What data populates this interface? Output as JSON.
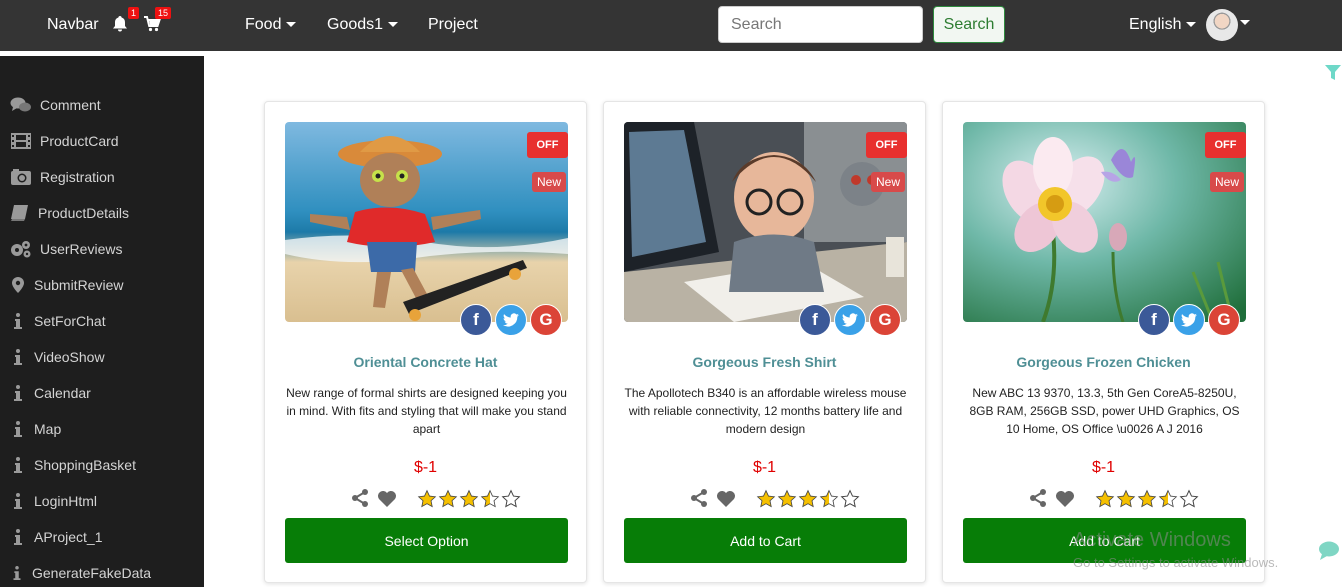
{
  "navbar": {
    "brand": "Navbar",
    "notifications_count": "1",
    "cart_count": "15",
    "menu": {
      "food": "Food",
      "goods": "Goods1",
      "project": "Project"
    },
    "search_placeholder": "Search",
    "search_button": "Search",
    "language": "English"
  },
  "sidebar": {
    "items": [
      {
        "label": "Comment",
        "icon": "comments-icon"
      },
      {
        "label": "ProductCard",
        "icon": "film-icon"
      },
      {
        "label": "Registration",
        "icon": "camera-icon"
      },
      {
        "label": "ProductDetails",
        "icon": "book-icon"
      },
      {
        "label": "UserReviews",
        "icon": "gears-icon"
      },
      {
        "label": "SubmitReview",
        "icon": "map-marker-icon"
      },
      {
        "label": "SetForChat",
        "icon": "info-icon"
      },
      {
        "label": "VideoShow",
        "icon": "info-icon"
      },
      {
        "label": "Calendar",
        "icon": "info-icon"
      },
      {
        "label": "Map",
        "icon": "info-icon"
      },
      {
        "label": "ShoppingBasket",
        "icon": "info-icon"
      },
      {
        "label": "LoginHtml",
        "icon": "info-icon"
      },
      {
        "label": "AProject_1",
        "icon": "info-icon"
      },
      {
        "label": "GenerateFakeData",
        "icon": "info-icon"
      }
    ]
  },
  "products": [
    {
      "title": "Oriental Concrete Hat",
      "description": "New range of formal shirts are designed keeping you in mind. With fits and styling that will make you stand apart",
      "price": "$-1",
      "tag_off": "OFF",
      "tag_new": "New",
      "rating": 3.5,
      "max_rating": 5,
      "button": "Select Option",
      "image": "cat-on-skateboard-beach"
    },
    {
      "title": "Gorgeous Fresh Shirt",
      "description": "The Apollotech B340 is an affordable wireless mouse with reliable connectivity, 12 months battery life and modern design",
      "price": "$-1",
      "tag_off": "OFF",
      "tag_new": "New",
      "rating": 3.5,
      "max_rating": 5,
      "button": "Add to Cart",
      "image": "boy-at-computer-with-robot"
    },
    {
      "title": "Gorgeous Frozen Chicken",
      "description": "New ABC 13 9370, 13.3, 5th Gen CoreA5-8250U, 8GB RAM, 256GB SSD, power UHD Graphics, OS 10 Home, OS Office \\u0026 A J 2016",
      "price": "$-1",
      "tag_off": "OFF",
      "tag_new": "New",
      "rating": 3.5,
      "max_rating": 5,
      "button": "Add to Cart",
      "image": "flower-with-butterfly"
    }
  ],
  "social": {
    "facebook": "f",
    "twitter": "twitter-bird-icon",
    "google": "G"
  },
  "colors": {
    "navbar_bg": "#343434",
    "sidebar_bg": "#1e1e1e",
    "title_color": "#4f8f95",
    "price_color": "#e00000",
    "cta_bg": "#077d07",
    "tag_off_bg": "#e8302f",
    "star_color": "#f5c000"
  },
  "watermark": {
    "title": "Activate Windows",
    "subtitle": "Go to Settings to activate Windows."
  }
}
